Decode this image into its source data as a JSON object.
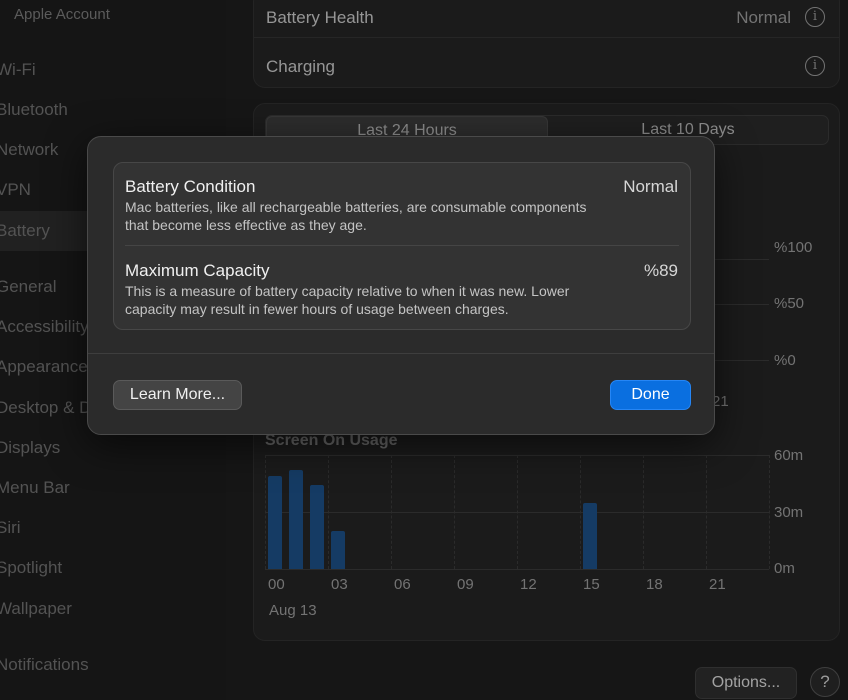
{
  "sidebar": {
    "account_label": "Apple Account",
    "items": [
      {
        "label": "Wi-Fi"
      },
      {
        "label": "Bluetooth"
      },
      {
        "label": "Network"
      },
      {
        "label": "VPN"
      },
      {
        "label": "Battery"
      },
      {
        "label": "General"
      },
      {
        "label": "Accessibility"
      },
      {
        "label": "Appearance"
      },
      {
        "label": "Desktop & D"
      },
      {
        "label": "Displays"
      },
      {
        "label": "Menu Bar"
      },
      {
        "label": "Siri"
      },
      {
        "label": "Spotlight"
      },
      {
        "label": "Wallpaper"
      },
      {
        "label": "Notifications"
      }
    ]
  },
  "battery_health": {
    "label": "Battery Health",
    "value": "Normal"
  },
  "charging": {
    "label": "Charging"
  },
  "range_tabs": [
    {
      "label": "Last 24 Hours"
    },
    {
      "label": "Last 10 Days"
    }
  ],
  "level_axis": {
    "ticks": [
      "%100",
      "%50",
      "%0"
    ],
    "partial_x_label": "21"
  },
  "screen_chart": {
    "title": "Screen On Usage",
    "y_ticks": [
      "60m",
      "30m",
      "0m"
    ],
    "x_ticks": [
      "00",
      "03",
      "06",
      "09",
      "12",
      "15",
      "18",
      "21"
    ],
    "date_label": "Aug 13"
  },
  "chart_data": {
    "type": "bar",
    "title": "Screen On Usage",
    "x": [
      "00:00",
      "01:00",
      "02:00",
      "03:00",
      "15:00"
    ],
    "values": [
      49,
      52,
      44,
      20,
      35
    ],
    "ylim": [
      0,
      60
    ],
    "y_unit": "minutes"
  },
  "footer": {
    "options_label": "Options...",
    "help_label": "?"
  },
  "modal": {
    "condition": {
      "title": "Battery Condition",
      "value": "Normal",
      "description": "Mac batteries, like all rechargeable batteries, are consumable components that become less effective as they age."
    },
    "capacity": {
      "title": "Maximum Capacity",
      "value": "%89",
      "description": "This is a measure of battery capacity relative to when it was new. Lower capacity may result in fewer hours of usage between charges."
    },
    "learn_more_label": "Learn More...",
    "done_label": "Done"
  },
  "colors": {
    "accent": "#0a6fe0",
    "bar": "#1c4f86"
  }
}
